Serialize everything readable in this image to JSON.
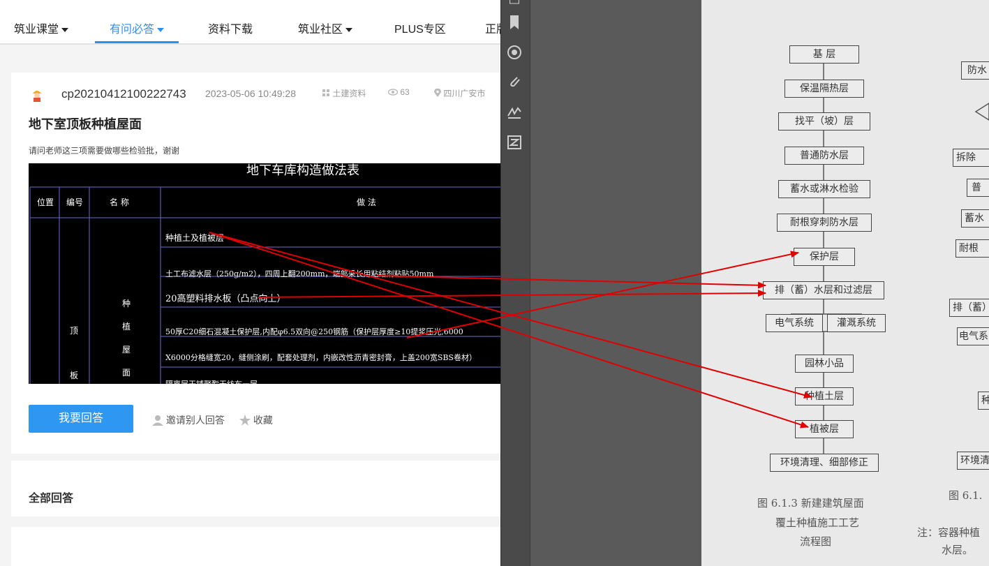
{
  "nav": {
    "items": [
      {
        "label": "筑业课堂",
        "dropdown": true
      },
      {
        "label": "有问必答",
        "dropdown": true,
        "active": true
      },
      {
        "label": "资料下载"
      },
      {
        "label": "筑业社区",
        "dropdown": true
      },
      {
        "label": "PLUS专区"
      },
      {
        "label": "正版"
      }
    ]
  },
  "post": {
    "username": "cp20210412100222743",
    "datetime": "2023-05-06 10:49:28",
    "category": "土建资料",
    "views": "63",
    "location": "四川广安市",
    "title": "地下室顶板种植屋面",
    "question": "请问老师这三项需要做哪些检验批，谢谢"
  },
  "image": {
    "title": "地下车库构造做法表",
    "headers": [
      "位置",
      "编号",
      "名 称",
      "做 法"
    ],
    "position": "顶板",
    "name": "种植屋面",
    "rows": [
      "种植土及植被层",
      "土工布滤水层（250g/m2），四周上翻200mm，端部采长用粘结剂粘贴50mm",
      "20高塑料排水板（凸点向上）",
      "50厚C20细石混凝土保护层,内配φ6.5双向@250钢筋（保护层厚度≥10提浆压光,6000",
      "X6000分格缝宽20，缝侧涂刷，配套处理剂，内嵌改性沥青密封膏，上盖200宽SBS卷材）",
      "隔离层干铺聚酯无纺布一层"
    ]
  },
  "actions": {
    "answer": "我要回答",
    "invite": "邀请别人回答",
    "favorite": "收藏"
  },
  "answers": {
    "heading": "全部回答"
  },
  "pdf": {
    "toolbar_icons": [
      "bookmark-icon",
      "target-icon",
      "attachment-icon",
      "signature-icon",
      "compare-icon"
    ],
    "flow": [
      "基  层",
      "保温隔热层",
      "找平（坡）层",
      "普通防水层",
      "蓄水或淋水检验",
      "耐根穿刺防水层",
      "保护层",
      "排（蓄）水层和过滤层",
      "电气系统",
      "灌溉系统",
      "园林小品",
      "种植土层",
      "植被层",
      "环境清理、细部修正"
    ],
    "caption_line1": "图 6.1.3   新建建筑屋面",
    "caption_line2": "覆土种植施工工艺",
    "caption_line3": "流程图",
    "right_partial": [
      "防水",
      "拆除",
      "普",
      "蓄水",
      "耐根",
      "排（蓄）",
      "电气系",
      "种",
      "环境清",
      "图 6.1.",
      "注：容器种植",
      "水层。"
    ]
  },
  "colors": {
    "accent": "#2e8ef0",
    "arrow": "#e00000"
  }
}
